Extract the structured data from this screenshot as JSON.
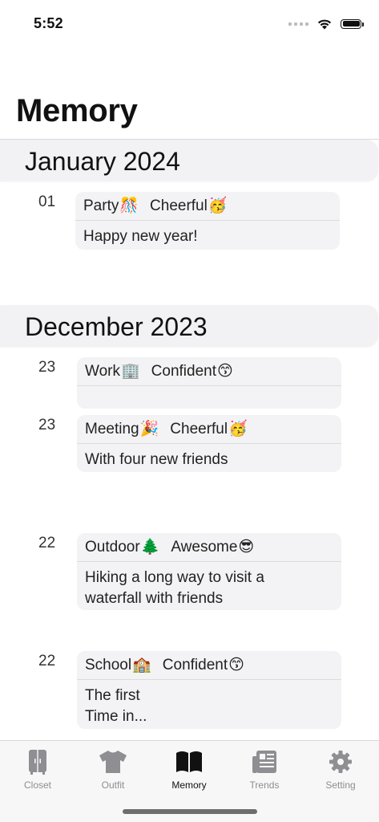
{
  "status": {
    "time": "5:52"
  },
  "title": "Memory",
  "months": [
    {
      "label": "January 2024",
      "entries": [
        {
          "day": "01",
          "tag1": "Party",
          "tag1_icon": "🎊",
          "tag2": "Cheerful",
          "tag2_icon": "🥳",
          "note": "Happy new year!"
        }
      ]
    },
    {
      "label": "December 2023",
      "entries": [
        {
          "day": "23",
          "tag1": "Work",
          "tag1_icon": "🏢",
          "tag2": "Confident",
          "tag2_icon": "😙",
          "note": ""
        },
        {
          "day": "23",
          "tag1": "Meeting",
          "tag1_icon": "🎉",
          "tag2": "Cheerful",
          "tag2_icon": "🥳",
          "note": "With four new friends"
        },
        {
          "day": "22",
          "tag1": "Outdoor",
          "tag1_icon": "🌲",
          "tag2": "Awesome",
          "tag2_icon": "😎",
          "note": "Hiking a long way to visit a\nwaterfall with friends"
        },
        {
          "day": "22",
          "tag1": "School",
          "tag1_icon": "🏫",
          "tag2": "Confident",
          "tag2_icon": "😙",
          "note": "The first\nTime in..."
        }
      ]
    }
  ],
  "tabs": [
    {
      "label": "Closet",
      "icon": "closet-icon"
    },
    {
      "label": "Outfit",
      "icon": "tshirt-icon"
    },
    {
      "label": "Memory",
      "icon": "book-icon",
      "active": true
    },
    {
      "label": "Trends",
      "icon": "newspaper-icon"
    },
    {
      "label": "Setting",
      "icon": "gear-icon"
    }
  ],
  "colors": {
    "tab_inactive": "#8e8e93",
    "tab_active": "#111111",
    "card_bg": "#f3f3f5",
    "header_bg": "#f2f2f4"
  }
}
